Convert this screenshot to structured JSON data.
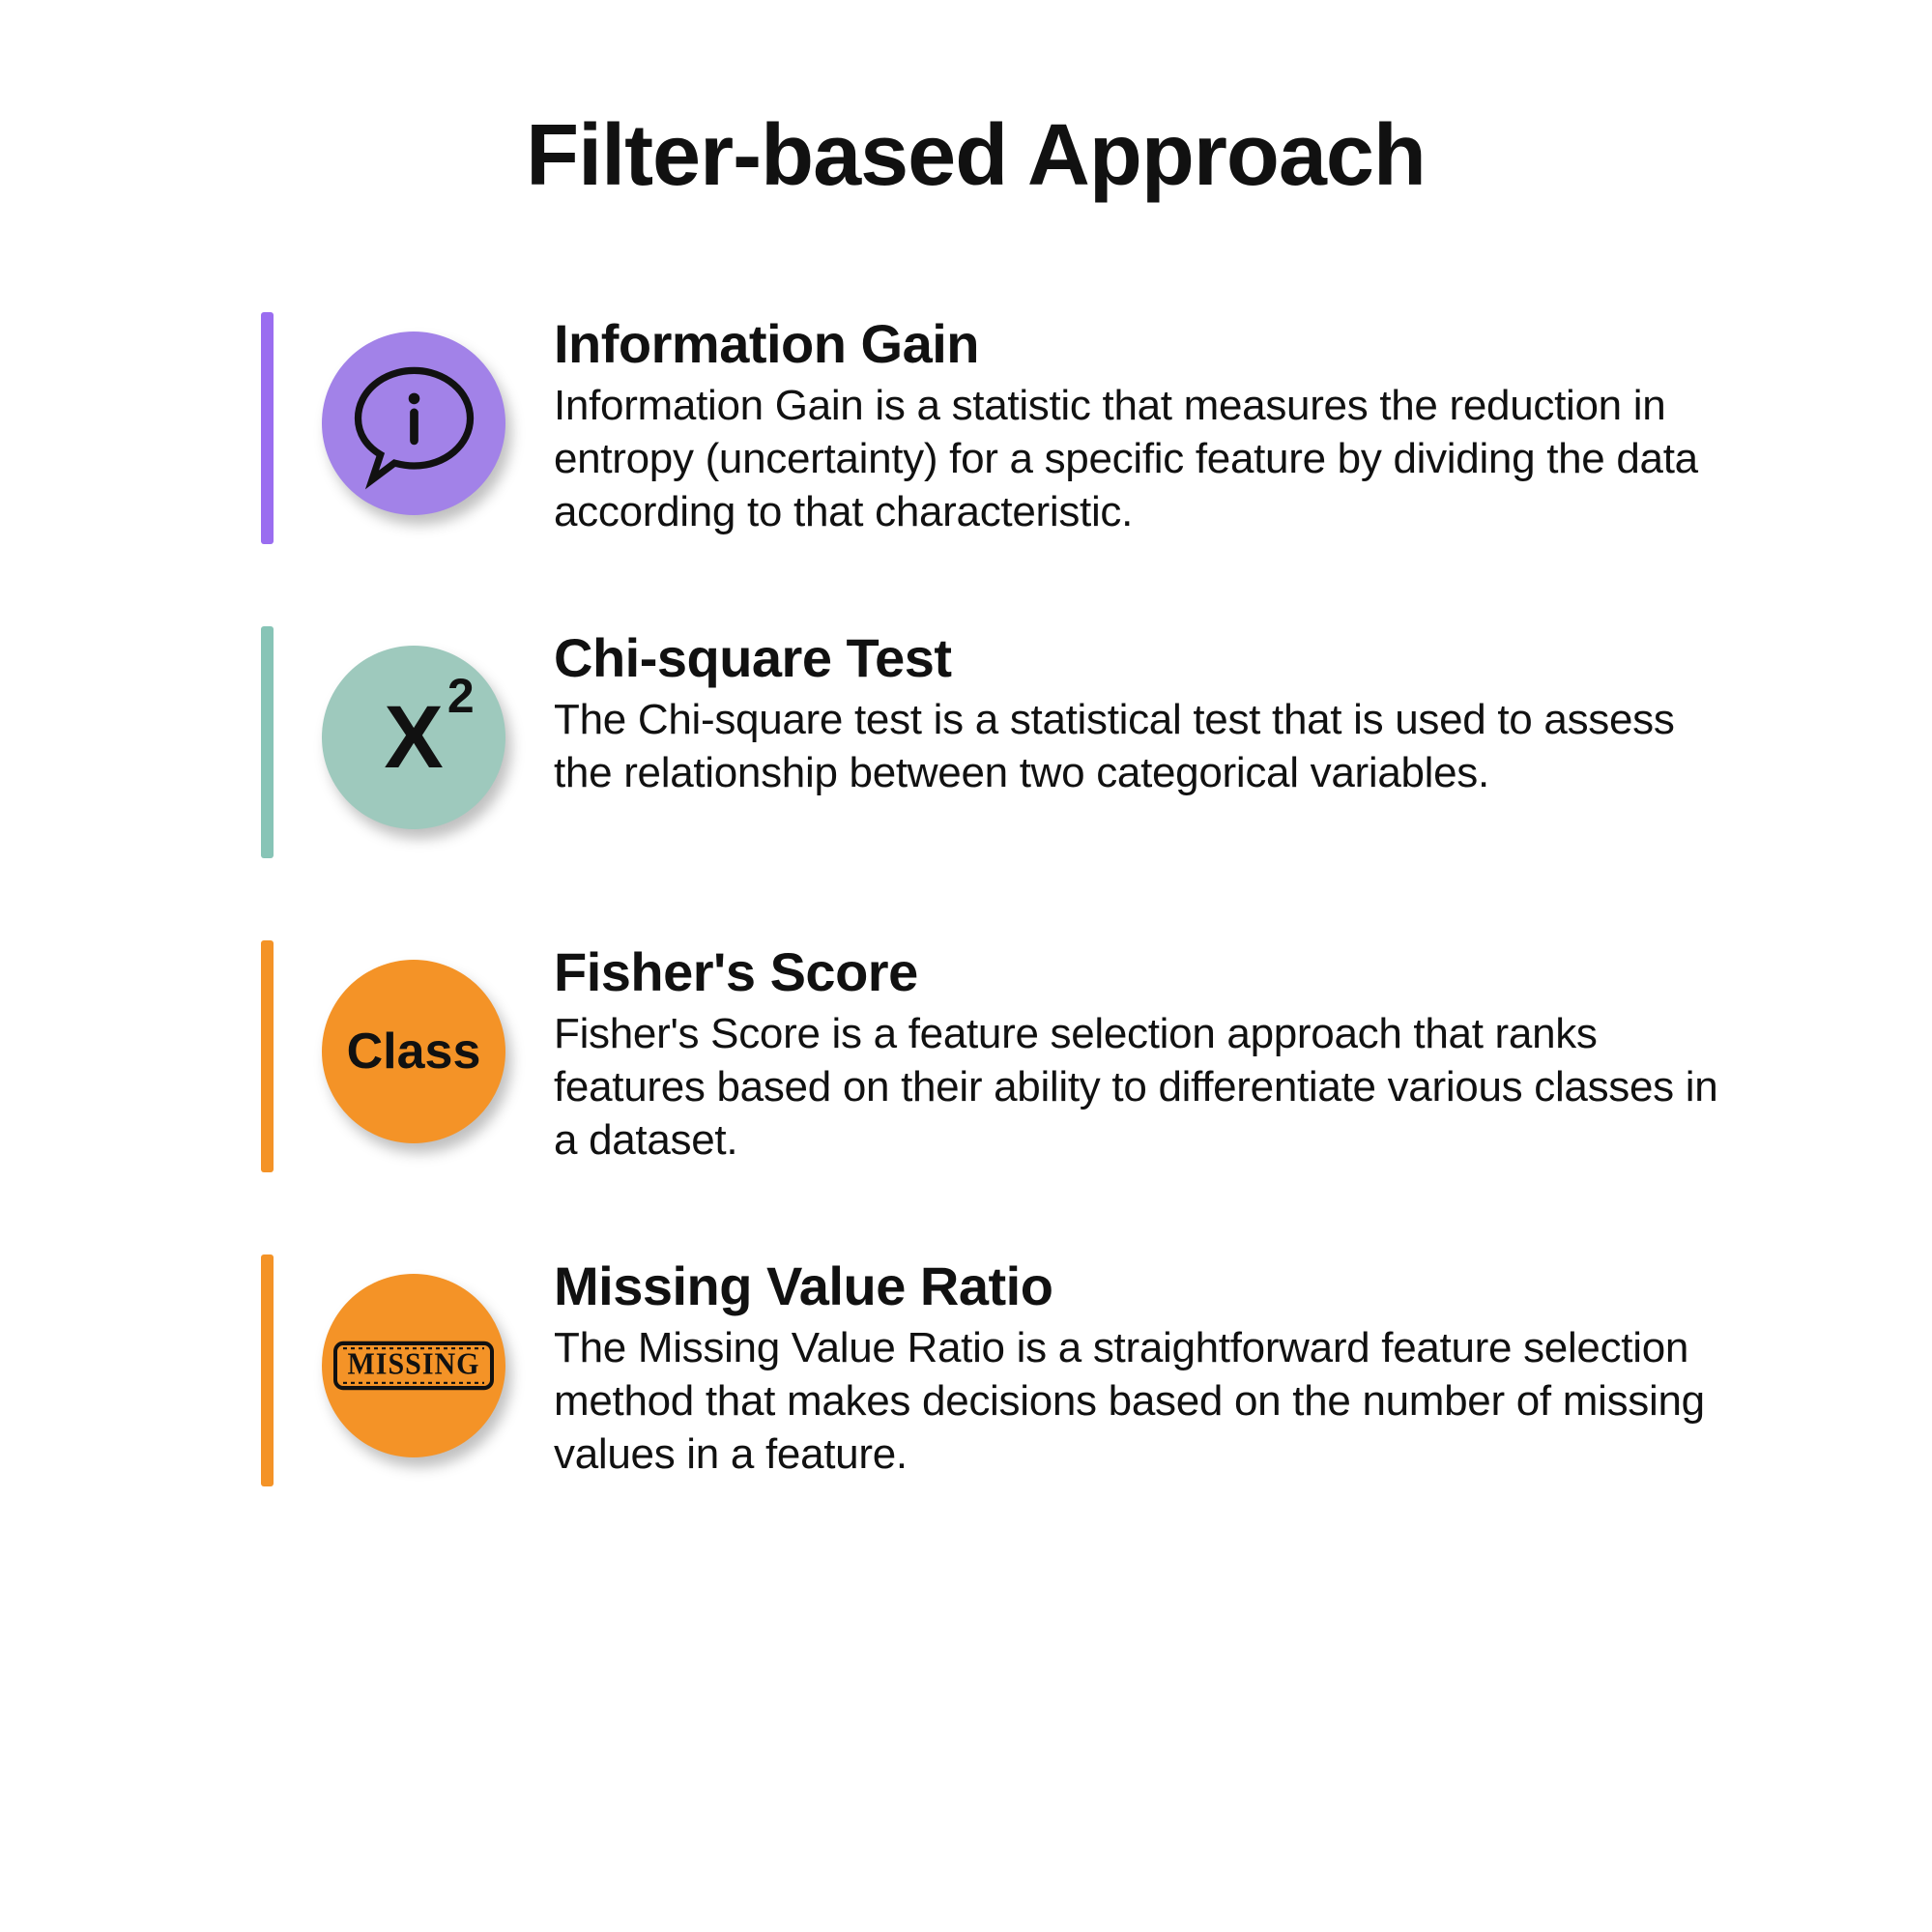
{
  "title": "Filter-based Approach",
  "items": [
    {
      "heading": "Information Gain",
      "desc": "Information Gain is a statistic that measures the reduction in entropy (uncertainty) for a specific feature by dividing the data according to that characteristic.",
      "icon": "info-speech-bubble-icon",
      "bar_color": "#9a6df0",
      "icon_bg": "#a282e8"
    },
    {
      "heading": "Chi-square Test",
      "desc": "The Chi-square test is a statistical test that is used to assess the relationship between two categorical variables.",
      "icon": "chi-square-icon",
      "icon_text_main": "X",
      "icon_text_sup": "2",
      "bar_color": "#87c4b6",
      "icon_bg": "#9ec9bd"
    },
    {
      "heading": "Fisher's Score",
      "desc": "Fisher's Score  is a feature selection approach that ranks features based on their ability to differentiate various classes in a dataset.",
      "icon": "class-label-icon",
      "icon_text": "Class",
      "bar_color": "#f49327",
      "icon_bg": "#f49327"
    },
    {
      "heading": "Missing Value Ratio",
      "desc": "The Missing Value Ratio is a straightforward feature selection method that makes decisions based on the number of missing values in a feature.",
      "icon": "missing-stamp-icon",
      "icon_text": "MISSING",
      "bar_color": "#f49327",
      "icon_bg": "#f49327"
    }
  ]
}
